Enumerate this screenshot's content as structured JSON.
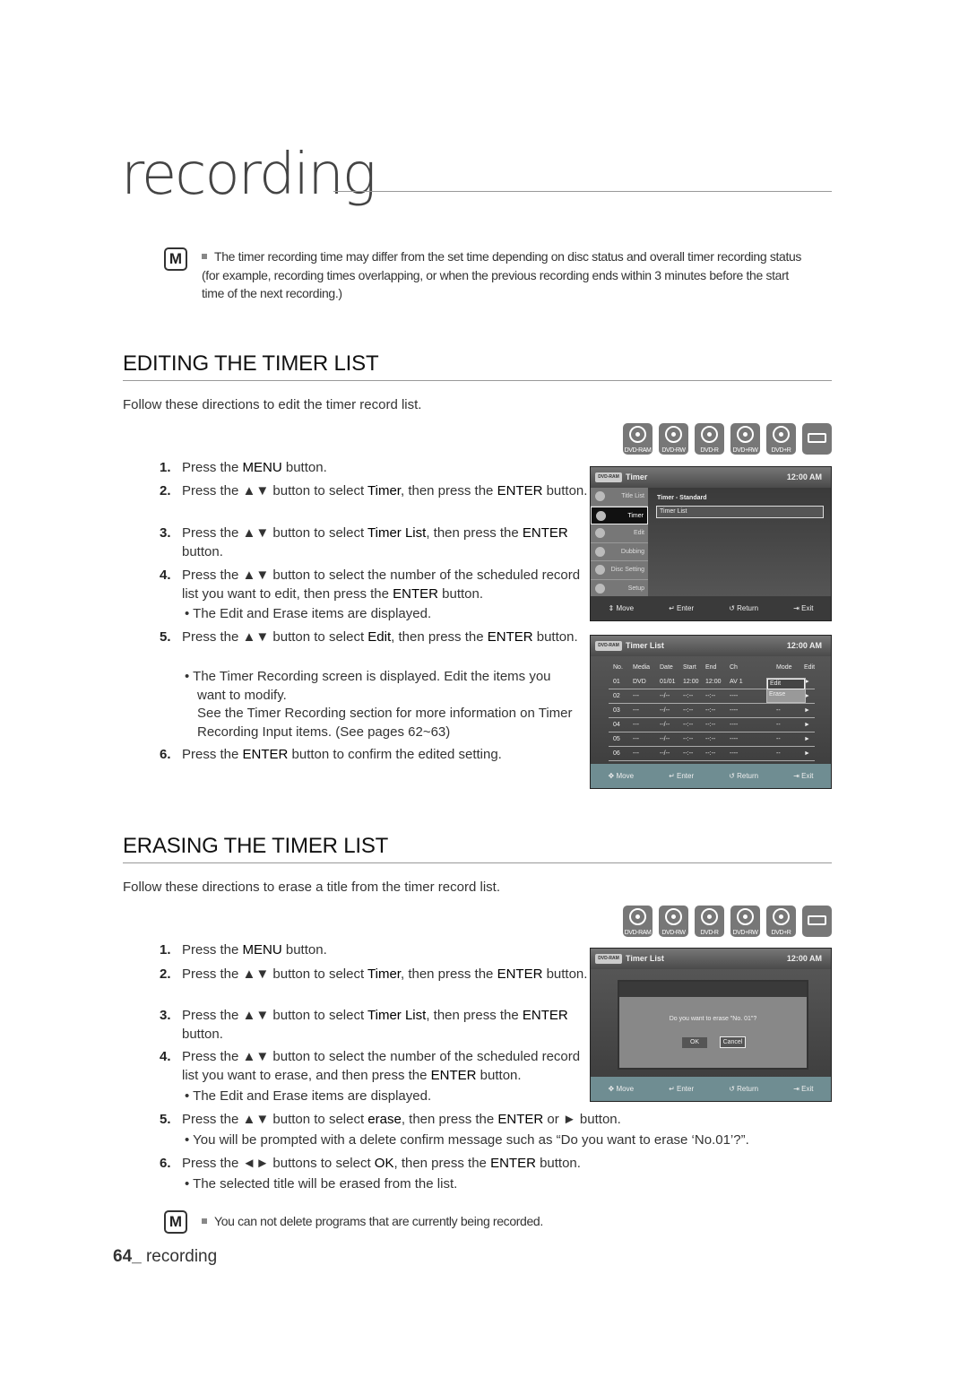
{
  "chapter_title": "recording",
  "note1": {
    "icon": "note-icon",
    "text": "The timer recording time may differ from the set time depending on disc status and overall timer recording status (for example, recording times overlapping, or when the previous recording ends within 3 minutes before the start time of the next recording.)"
  },
  "discs": [
    "DVD-RAM",
    "DVD-RW",
    "DVD-R",
    "DVD+RW",
    "DVD+R"
  ],
  "editing": {
    "heading": "EDITING THE TIMER LIST",
    "intro": "Follow these directions to edit the timer record list.",
    "steps": [
      {
        "n": "1.",
        "html": "Press the <b>MENU</b> button."
      },
      {
        "n": "2.",
        "html": "Press the ▲▼ button to select <b>Timer</b>, then press the <b>ENTER</b> button."
      },
      {
        "n": "3.",
        "html": "Press the ▲▼ button to select <b>Timer List</b>, then press the <b>ENTER</b> button."
      },
      {
        "n": "4.",
        "html": "Press the ▲▼ button to select the number of the scheduled record list you want to edit, then press the <b>ENTER</b> button."
      },
      {
        "n": "5.",
        "html": "Press the ▲▼ button to select <b>Edit</b>, then press the <b>ENTER</b> button."
      },
      {
        "n": "6.",
        "html": "Press the <b>ENTER</b> button to confirm the edited setting."
      }
    ],
    "bullet4": "The Edit and Erase items are displayed.",
    "bullet5": "The Timer Recording screen is displayed. Edit the items you want to modify.",
    "bullet5b": "See the Timer Recording section for more information on Timer Recording Input items. (See pages 62~63)"
  },
  "erasing": {
    "heading": "ERASING THE TIMER LIST",
    "intro": "Follow these directions to erase a title from the timer record list.",
    "steps": [
      {
        "n": "1.",
        "html": "Press the <b>MENU</b> button."
      },
      {
        "n": "2.",
        "html": "Press the ▲▼ button to select <b>Timer</b>, then press the <b>ENTER</b> button."
      },
      {
        "n": "3.",
        "html": "Press the ▲▼ button to select <b>Timer List</b>, then press the <b>ENTER</b> button."
      },
      {
        "n": "4.",
        "html": "Press the ▲▼ button to select the number of the scheduled record list you want to erase, and then press the <b>ENTER</b> button."
      },
      {
        "n": "5.",
        "html": "Press the ▲▼ button to select <b>erase</b>, then press the <b>ENTER</b> or ► button."
      },
      {
        "n": "6.",
        "html": "Press the ◄► buttons to select <b>OK</b>, then press the <b>ENTER</b> button."
      }
    ],
    "bullet4": "The Edit and Erase items are displayed.",
    "bullet5": "You will be prompted with a delete confirm message such as “Do you want to erase ‘No.01’?”.",
    "bullet6": "The selected title will be erased from the list."
  },
  "note2": {
    "icon": "note-icon",
    "text": "You can not delete programs that are currently being recorded."
  },
  "footer": {
    "page": "64_",
    "label": "recording"
  },
  "screen_common": {
    "badge": "DVD-RAM",
    "clock": "12:00 AM",
    "move": "Move",
    "enter": "Enter",
    "return": "Return",
    "exit": "Exit"
  },
  "screen1": {
    "title": "Timer",
    "menu": [
      "Title List",
      "Timer",
      "Edit",
      "Dubbing",
      "Disc Setting",
      "Setup"
    ],
    "selected": 1,
    "items": [
      "Timer - Standard",
      "Timer List"
    ]
  },
  "screen2": {
    "title": "Timer List",
    "headers": [
      "No.",
      "Media",
      "Date",
      "Start",
      "End",
      "Ch",
      "Mode",
      "Edit"
    ],
    "rows": [
      [
        "01",
        "DVD",
        "01/01",
        "12:00",
        "12:00",
        "AV 1",
        "",
        "►"
      ],
      [
        "02",
        "---",
        "--/--",
        "--:--",
        "--:--",
        "----",
        "--",
        "►"
      ],
      [
        "03",
        "---",
        "--/--",
        "--:--",
        "--:--",
        "----",
        "--",
        "►"
      ],
      [
        "04",
        "---",
        "--/--",
        "--:--",
        "--:--",
        "----",
        "--",
        "►"
      ],
      [
        "05",
        "---",
        "--/--",
        "--:--",
        "--:--",
        "----",
        "--",
        "►"
      ],
      [
        "06",
        "---",
        "--/--",
        "--:--",
        "--:--",
        "----",
        "--",
        "►"
      ]
    ],
    "popup": [
      "Edit",
      "Erase"
    ]
  },
  "screen3": {
    "title": "Timer List",
    "message": "Do you want to erase \"No. 01\"?",
    "ok": "OK",
    "cancel": "Cancel"
  }
}
